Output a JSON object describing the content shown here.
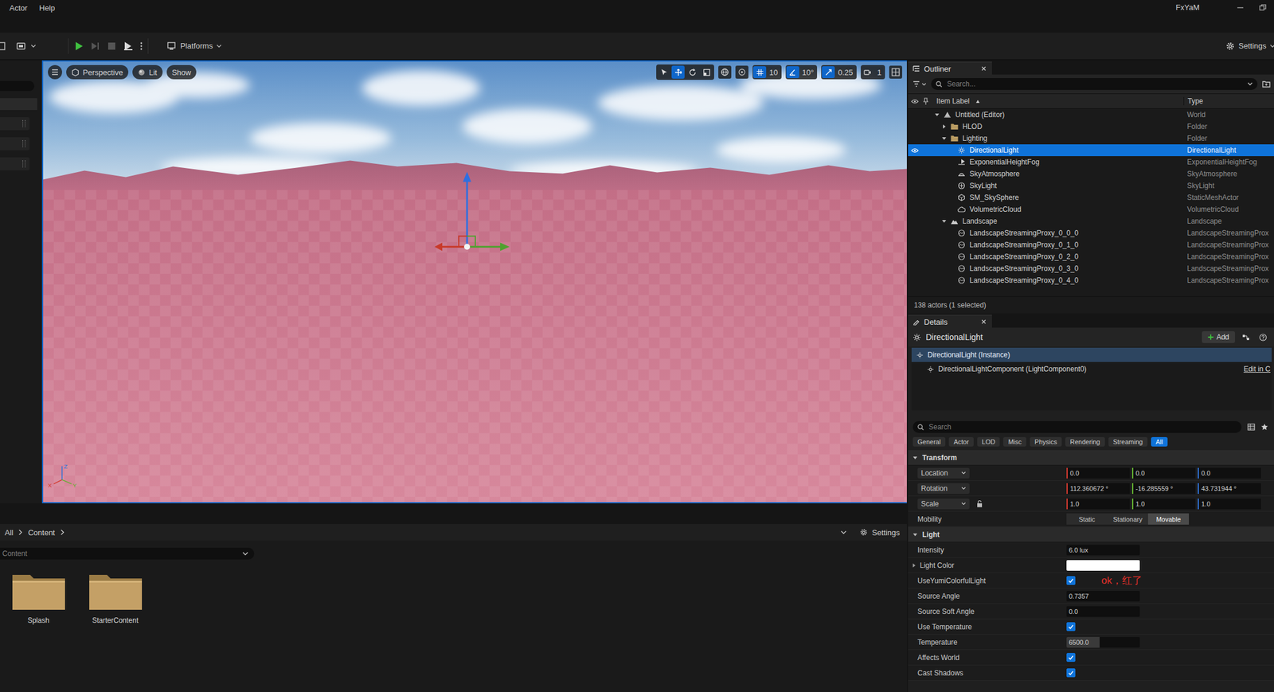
{
  "menu": [
    {
      "label": "Actor"
    },
    {
      "label": "Help"
    }
  ],
  "user": "FxYaM",
  "toolbar": {
    "platforms": "Platforms",
    "settings": "Settings",
    "play_controls": [
      {
        "control": "play",
        "enabled": true
      },
      {
        "control": "advance-frame",
        "enabled": false
      },
      {
        "control": "stop",
        "enabled": false
      },
      {
        "control": "eject",
        "enabled": true
      }
    ]
  },
  "viewport": {
    "buttons": [
      {
        "label": "Perspective",
        "kind": "perspective"
      },
      {
        "label": "Lit",
        "kind": "lit"
      },
      {
        "label": "Show",
        "kind": "plain"
      }
    ],
    "tools": [
      {
        "tool": "select",
        "selected": false
      },
      {
        "tool": "translate",
        "selected": true
      },
      {
        "tool": "rotate",
        "selected": false
      },
      {
        "tool": "scale",
        "selected": false
      }
    ],
    "snaps": [
      {
        "tool": "grid",
        "value": "10",
        "on": true
      },
      {
        "tool": "angle",
        "value": "10°",
        "on": true
      },
      {
        "tool": "scale",
        "value": "0.25",
        "on": true
      },
      {
        "tool": "camera-speed",
        "value": "1",
        "on": false
      }
    ],
    "axis_labels": [
      "Z",
      "X",
      "Y"
    ]
  },
  "content_browser": {
    "breadcrumb": [
      "All",
      "Content"
    ],
    "settings": "Settings",
    "path": "Content",
    "folders": [
      "Splash",
      "StarterContent"
    ]
  },
  "outliner": {
    "tab": "Outliner",
    "search_placeholder": "Search...",
    "columns": [
      "Item Label",
      "Type"
    ],
    "rows": [
      {
        "label": "Untitled (Editor)",
        "type": "World",
        "depth": 0,
        "kind": "world",
        "has_children": true,
        "expanded": true,
        "selected": false,
        "eye": false
      },
      {
        "label": "HLOD",
        "type": "Folder",
        "depth": 1,
        "kind": "folder",
        "has_children": true,
        "expanded": false,
        "selected": false,
        "eye": false
      },
      {
        "label": "Lighting",
        "type": "Folder",
        "depth": 1,
        "kind": "folder",
        "has_children": true,
        "expanded": true,
        "selected": false,
        "eye": false
      },
      {
        "label": "DirectionalLight",
        "type": "DirectionalLight",
        "depth": 2,
        "kind": "light",
        "has_children": false,
        "expanded": false,
        "selected": true,
        "eye": true
      },
      {
        "label": "ExponentialHeightFog",
        "type": "ExponentialHeightFog",
        "depth": 2,
        "kind": "fog",
        "has_children": false,
        "expanded": false,
        "selected": false,
        "eye": false
      },
      {
        "label": "SkyAtmosphere",
        "type": "SkyAtmosphere",
        "depth": 2,
        "kind": "atmosphere",
        "has_children": false,
        "expanded": false,
        "selected": false,
        "eye": false
      },
      {
        "label": "SkyLight",
        "type": "SkyLight",
        "depth": 2,
        "kind": "skylight",
        "has_children": false,
        "expanded": false,
        "selected": false,
        "eye": false
      },
      {
        "label": "SM_SkySphere",
        "type": "StaticMeshActor",
        "depth": 2,
        "kind": "mesh",
        "has_children": false,
        "expanded": false,
        "selected": false,
        "eye": false
      },
      {
        "label": "VolumetricCloud",
        "type": "VolumetricCloud",
        "depth": 2,
        "kind": "cloud",
        "has_children": false,
        "expanded": false,
        "selected": false,
        "eye": false
      },
      {
        "label": "Landscape",
        "type": "Landscape",
        "depth": 1,
        "kind": "landscape",
        "has_children": true,
        "expanded": true,
        "selected": false,
        "eye": false
      },
      {
        "label": "LandscapeStreamingProxy_0_0_0",
        "type": "LandscapeStreamingProx",
        "depth": 2,
        "kind": "proxy",
        "has_children": false,
        "expanded": false,
        "selected": false,
        "eye": false
      },
      {
        "label": "LandscapeStreamingProxy_0_1_0",
        "type": "LandscapeStreamingProx",
        "depth": 2,
        "kind": "proxy",
        "has_children": false,
        "expanded": false,
        "selected": false,
        "eye": false
      },
      {
        "label": "LandscapeStreamingProxy_0_2_0",
        "type": "LandscapeStreamingProx",
        "depth": 2,
        "kind": "proxy",
        "has_children": false,
        "expanded": false,
        "selected": false,
        "eye": false
      },
      {
        "label": "LandscapeStreamingProxy_0_3_0",
        "type": "LandscapeStreamingProx",
        "depth": 2,
        "kind": "proxy",
        "has_children": false,
        "expanded": false,
        "selected": false,
        "eye": false
      },
      {
        "label": "LandscapeStreamingProxy_0_4_0",
        "type": "LandscapeStreamingProx",
        "depth": 2,
        "kind": "proxy",
        "has_children": false,
        "expanded": false,
        "selected": false,
        "eye": false
      }
    ],
    "footer": "138 actors (1 selected)"
  },
  "details": {
    "tab": "Details",
    "title": "DirectionalLight",
    "add_button": "Add",
    "components": [
      {
        "label": "DirectionalLight (Instance)",
        "selected": true
      },
      {
        "label": "DirectionalLightComponent (LightComponent0)",
        "selected": false
      }
    ],
    "edit_link": "Edit in C",
    "search_placeholder": "Search",
    "filters": [
      {
        "label": "General",
        "selected": false
      },
      {
        "label": "Actor",
        "selected": false
      },
      {
        "label": "LOD",
        "selected": false
      },
      {
        "label": "Misc",
        "selected": false
      },
      {
        "label": "Physics",
        "selected": false
      },
      {
        "label": "Rendering",
        "selected": false
      },
      {
        "label": "Streaming",
        "selected": false
      },
      {
        "label": "All",
        "selected": true
      }
    ],
    "sections": [
      {
        "title": "Transform",
        "expanded": true,
        "rows": [
          {
            "kind": "vector",
            "label": "Location",
            "values": [
              "0.0",
              "0.0",
              "0.0"
            ]
          },
          {
            "kind": "vector",
            "label": "Rotation",
            "values": [
              "112.360672 °",
              "-16.285559 °",
              "43.731944 °"
            ]
          },
          {
            "kind": "vector",
            "label": "Scale",
            "values": [
              "1.0",
              "1.0",
              "1.0"
            ],
            "locked": false
          },
          {
            "kind": "segmented",
            "label": "Mobility",
            "options": [
              {
                "label": "Static",
                "selected": false
              },
              {
                "label": "Stationary",
                "selected": false
              },
              {
                "label": "Movable",
                "selected": true
              }
            ]
          }
        ]
      },
      {
        "title": "Light",
        "expanded": true,
        "rows": [
          {
            "kind": "number",
            "label": "Intensity",
            "value": "6.0 lux"
          },
          {
            "kind": "color",
            "label": "Light Color",
            "value_color": "#ffffff",
            "expanded": false
          },
          {
            "kind": "checkbox",
            "label": "UseYumiColorfulLight",
            "checked": true,
            "note": "ok，红了"
          },
          {
            "kind": "number",
            "label": "Source Angle",
            "value": "0.7357"
          },
          {
            "kind": "number",
            "label": "Source Soft Angle",
            "value": "0.0"
          },
          {
            "kind": "checkbox",
            "label": "Use Temperature",
            "checked": true
          },
          {
            "kind": "number",
            "label": "Temperature",
            "value": "6500.0",
            "level": 0.45
          },
          {
            "kind": "checkbox",
            "label": "Affects World",
            "checked": true
          },
          {
            "kind": "checkbox",
            "label": "Cast Shadows",
            "checked": true
          }
        ]
      }
    ]
  }
}
